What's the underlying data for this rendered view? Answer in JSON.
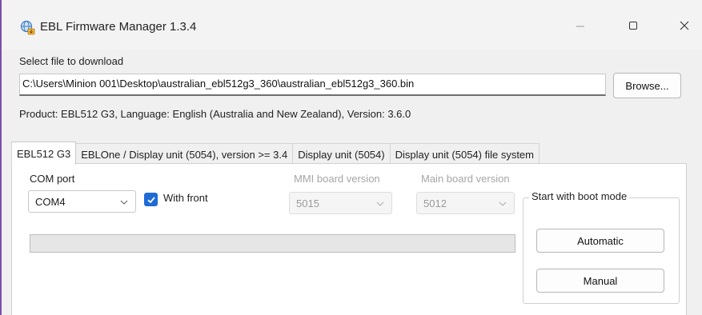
{
  "window": {
    "title": "EBL Firmware Manager 1.3.4",
    "icon": "globe-download-icon",
    "controls": {
      "minimize": "minimize-icon",
      "maximize": "maximize-icon",
      "close": "close-icon"
    }
  },
  "file": {
    "label": "Select file to download",
    "path": "C:\\Users\\Minion 001\\Desktop\\australian_ebl512g3_360\\australian_ebl512g3_360.bin",
    "browse_label": "Browse..."
  },
  "product_info": "Product: EBL512 G3, Language: English (Australia and New Zealand), Version: 3.6.0",
  "tabs": [
    {
      "label": "EBL512 G3",
      "active": true
    },
    {
      "label": "EBLOne / Display unit (5054), version >= 3.4",
      "active": false
    },
    {
      "label": "Display unit (5054)",
      "active": false
    },
    {
      "label": "Display unit (5054) file system",
      "active": false
    }
  ],
  "com": {
    "label": "COM port",
    "value": "COM4",
    "with_front_label": "With front",
    "with_front_checked": true
  },
  "mmi": {
    "label": "MMI board version",
    "value": "5015",
    "enabled": false
  },
  "main_board": {
    "label": "Main board version",
    "value": "5012",
    "enabled": false
  },
  "progress": {
    "value": 0
  },
  "boot_mode": {
    "label": "Start with boot mode",
    "automatic_label": "Automatic",
    "manual_label": "Manual"
  },
  "colors": {
    "accent": "#1f6bd6",
    "window_border": "#7b4ea8",
    "disabled_text": "#a6a6a6"
  }
}
